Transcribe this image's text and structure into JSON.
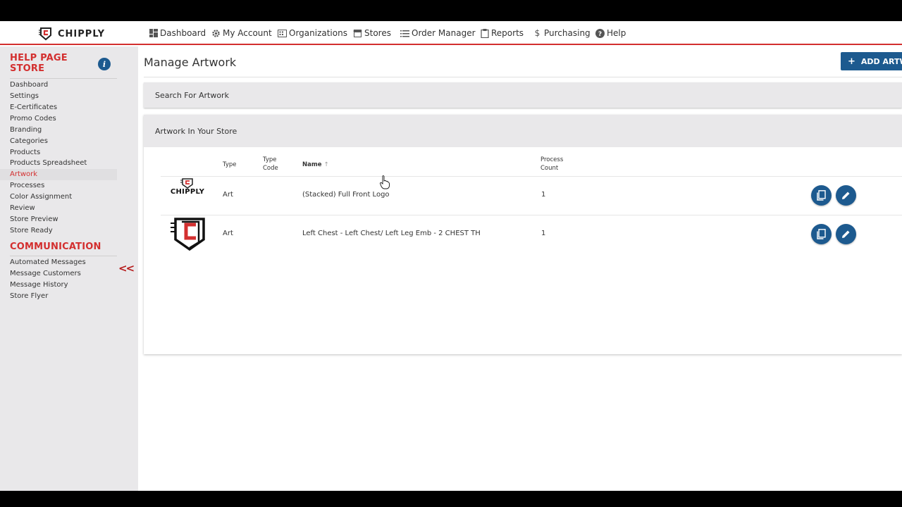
{
  "app": {
    "brand": "CHIPPLY",
    "accent_color": "#d32f2f",
    "primary_color": "#1d5a8f"
  },
  "nav": {
    "items": [
      {
        "label": "Dashboard",
        "icon": "dashboard-icon"
      },
      {
        "label": "My Account",
        "icon": "gear-icon"
      },
      {
        "label": "Organizations",
        "icon": "building-icon"
      },
      {
        "label": "Stores",
        "icon": "store-icon"
      },
      {
        "label": "Order Manager",
        "icon": "list-icon"
      },
      {
        "label": "Reports",
        "icon": "clipboard-icon"
      },
      {
        "label": "Purchasing",
        "icon": "dollar-icon"
      },
      {
        "label": "Help",
        "icon": "help-icon"
      }
    ]
  },
  "sidebar": {
    "section1_title": "HELP PAGE STORE",
    "info_label": "i",
    "store_items": [
      {
        "label": "Dashboard"
      },
      {
        "label": "Settings"
      },
      {
        "label": "E-Certificates"
      },
      {
        "label": "Promo Codes"
      },
      {
        "label": "Branding"
      },
      {
        "label": "Categories"
      },
      {
        "label": "Products"
      },
      {
        "label": "Products Spreadsheet"
      },
      {
        "label": "Artwork",
        "active": true
      },
      {
        "label": "Processes"
      },
      {
        "label": "Color Assignment"
      },
      {
        "label": "Review"
      },
      {
        "label": "Store Preview"
      },
      {
        "label": "Store Ready"
      }
    ],
    "section2_title": "COMMUNICATION",
    "comm_items": [
      {
        "label": "Automated Messages"
      },
      {
        "label": "Message Customers"
      },
      {
        "label": "Message History"
      },
      {
        "label": "Store Flyer"
      }
    ],
    "collapse_label": "<<"
  },
  "main": {
    "title": "Manage Artwork",
    "add_button": "ADD ARTWORK",
    "search_panel": "Search For Artwork",
    "artwork_panel": "Artwork In Your Store",
    "columns": {
      "type": "Type",
      "type_code_1": "Type",
      "type_code_2": "Code",
      "name": "Name",
      "process_count_1": "Process",
      "process_count_2": "Count"
    },
    "rows": [
      {
        "thumb_text": "CHIPPLY",
        "type": "Art",
        "type_code": "",
        "name": "(Stacked) Full Front Logo",
        "process_count": "1"
      },
      {
        "thumb_text": "",
        "type": "Art",
        "type_code": "",
        "name": "Left Chest - Left Chest/ Left Leg Emb - 2 CHEST TH",
        "process_count": "1"
      }
    ]
  }
}
